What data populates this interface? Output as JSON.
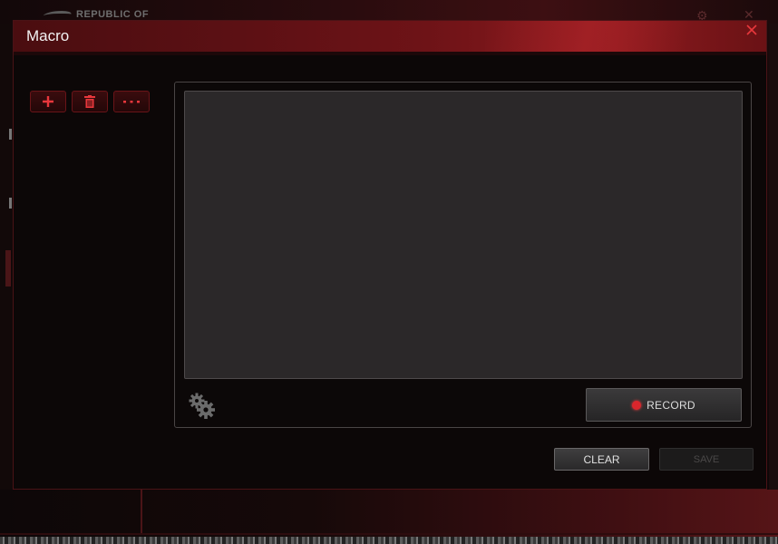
{
  "background_app": {
    "brand": "REPUBLIC OF",
    "icons": [
      "rog-eye-logo",
      "gear-icon",
      "close-icon"
    ]
  },
  "dialog": {
    "title": "Macro",
    "close_icon": "close-icon"
  },
  "toolbar": {
    "buttons": [
      {
        "name": "add-macro-button",
        "icon": "plus-icon"
      },
      {
        "name": "delete-macro-button",
        "icon": "trash-icon"
      },
      {
        "name": "more-options-button",
        "icon": "ellipsis-icon"
      }
    ]
  },
  "editor": {
    "settings_icon": "gears-icon",
    "record_label": "RECORD"
  },
  "footer": {
    "clear_label": "CLEAR",
    "save_label": "SAVE"
  },
  "colors": {
    "accent_red": "#d9262c",
    "header_red": "#6e1317",
    "panel_gray": "#2b2829",
    "background": "#0c0707"
  }
}
